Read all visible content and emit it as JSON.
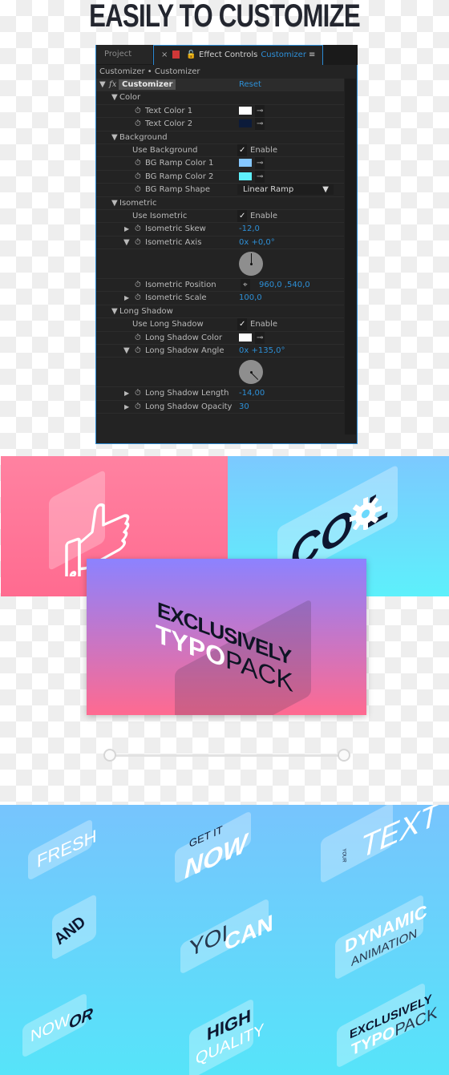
{
  "headline": "EASILY TO CUSTOMIZE",
  "panel": {
    "tabs": {
      "project": "Project",
      "close": "×",
      "lock": "🔓",
      "effect_controls": "Effect Controls",
      "composition": "Customizer",
      "menu": "≡"
    },
    "breadcrumb": "Customizer • Customizer",
    "effect": {
      "name": "Customizer",
      "reset": "Reset",
      "fx": "fx"
    },
    "color_section": "Color",
    "text_color_1": {
      "label": "Text Color 1",
      "swatch": "#ffffff"
    },
    "text_color_2": {
      "label": "Text Color 2",
      "swatch": "#0c1b3a"
    },
    "background_section": "Background",
    "use_background": {
      "label": "Use Background",
      "value": "Enable",
      "checked": true
    },
    "bg_ramp_color_1": {
      "label": "BG Ramp Color 1",
      "swatch": "#86c7ff"
    },
    "bg_ramp_color_2": {
      "label": "BG Ramp Color 2",
      "swatch": "#5ef0fb"
    },
    "bg_ramp_shape": {
      "label": "BG Ramp Shape",
      "value": "Linear Ramp"
    },
    "isometric_section": "Isometric",
    "use_isometric": {
      "label": "Use Isometric",
      "value": "Enable",
      "checked": true
    },
    "isometric_skew": {
      "label": "Isometric Skew",
      "value": "-12,0"
    },
    "isometric_axis": {
      "label": "Isometric Axis",
      "value": "0x +0,0°",
      "angle_deg": 0
    },
    "isometric_position": {
      "label": "Isometric Position",
      "value": "960,0 ,540,0"
    },
    "isometric_scale": {
      "label": "Isometric Scale",
      "value": "100,0"
    },
    "long_shadow_section": "Long Shadow",
    "use_long_shadow": {
      "label": "Use Long Shadow",
      "value": "Enable",
      "checked": true
    },
    "long_shadow_color": {
      "label": "Long Shadow Color",
      "swatch": "#ffffff"
    },
    "long_shadow_angle": {
      "label": "Long Shadow Angle",
      "value": "0x +135,0°",
      "angle_deg": 135
    },
    "long_shadow_length": {
      "label": "Long Shadow Length",
      "value": "-14,00"
    },
    "long_shadow_opacity": {
      "label": "Long Shadow Opacity",
      "value": "30"
    },
    "icons": {
      "stopwatch": "⏱",
      "eyedropper": "⊸",
      "expand": "▶",
      "collapse": "▼",
      "check": "✓",
      "dropdown": "▼",
      "target": "⌖"
    }
  },
  "cards": {
    "pink": {
      "icon": "thumbs-up"
    },
    "cyan": {
      "text": "CO L",
      "o_text": "O"
    },
    "purple": {
      "line1": "EXCLUSIVELY",
      "line2a": "TYPO",
      "line2b": "PACK"
    }
  },
  "slider": {
    "value_start": 0,
    "value_end": 1
  },
  "samples": {
    "fresh": "FRESH",
    "get_it": "GET IT",
    "now": "NOW",
    "your": "YOUR",
    "text": "TEXT",
    "and": "AND",
    "yo": "YOI",
    "can": "CAN",
    "dynamic": "DYNAMIC",
    "animation": "ANIMATION",
    "now2": "NOW",
    "or": "OR",
    "high": "HIGH",
    "quality": "QUALITY",
    "exclusively": "EXCLUSIVELY",
    "typo": "TYPO",
    "pack": "PACK"
  }
}
